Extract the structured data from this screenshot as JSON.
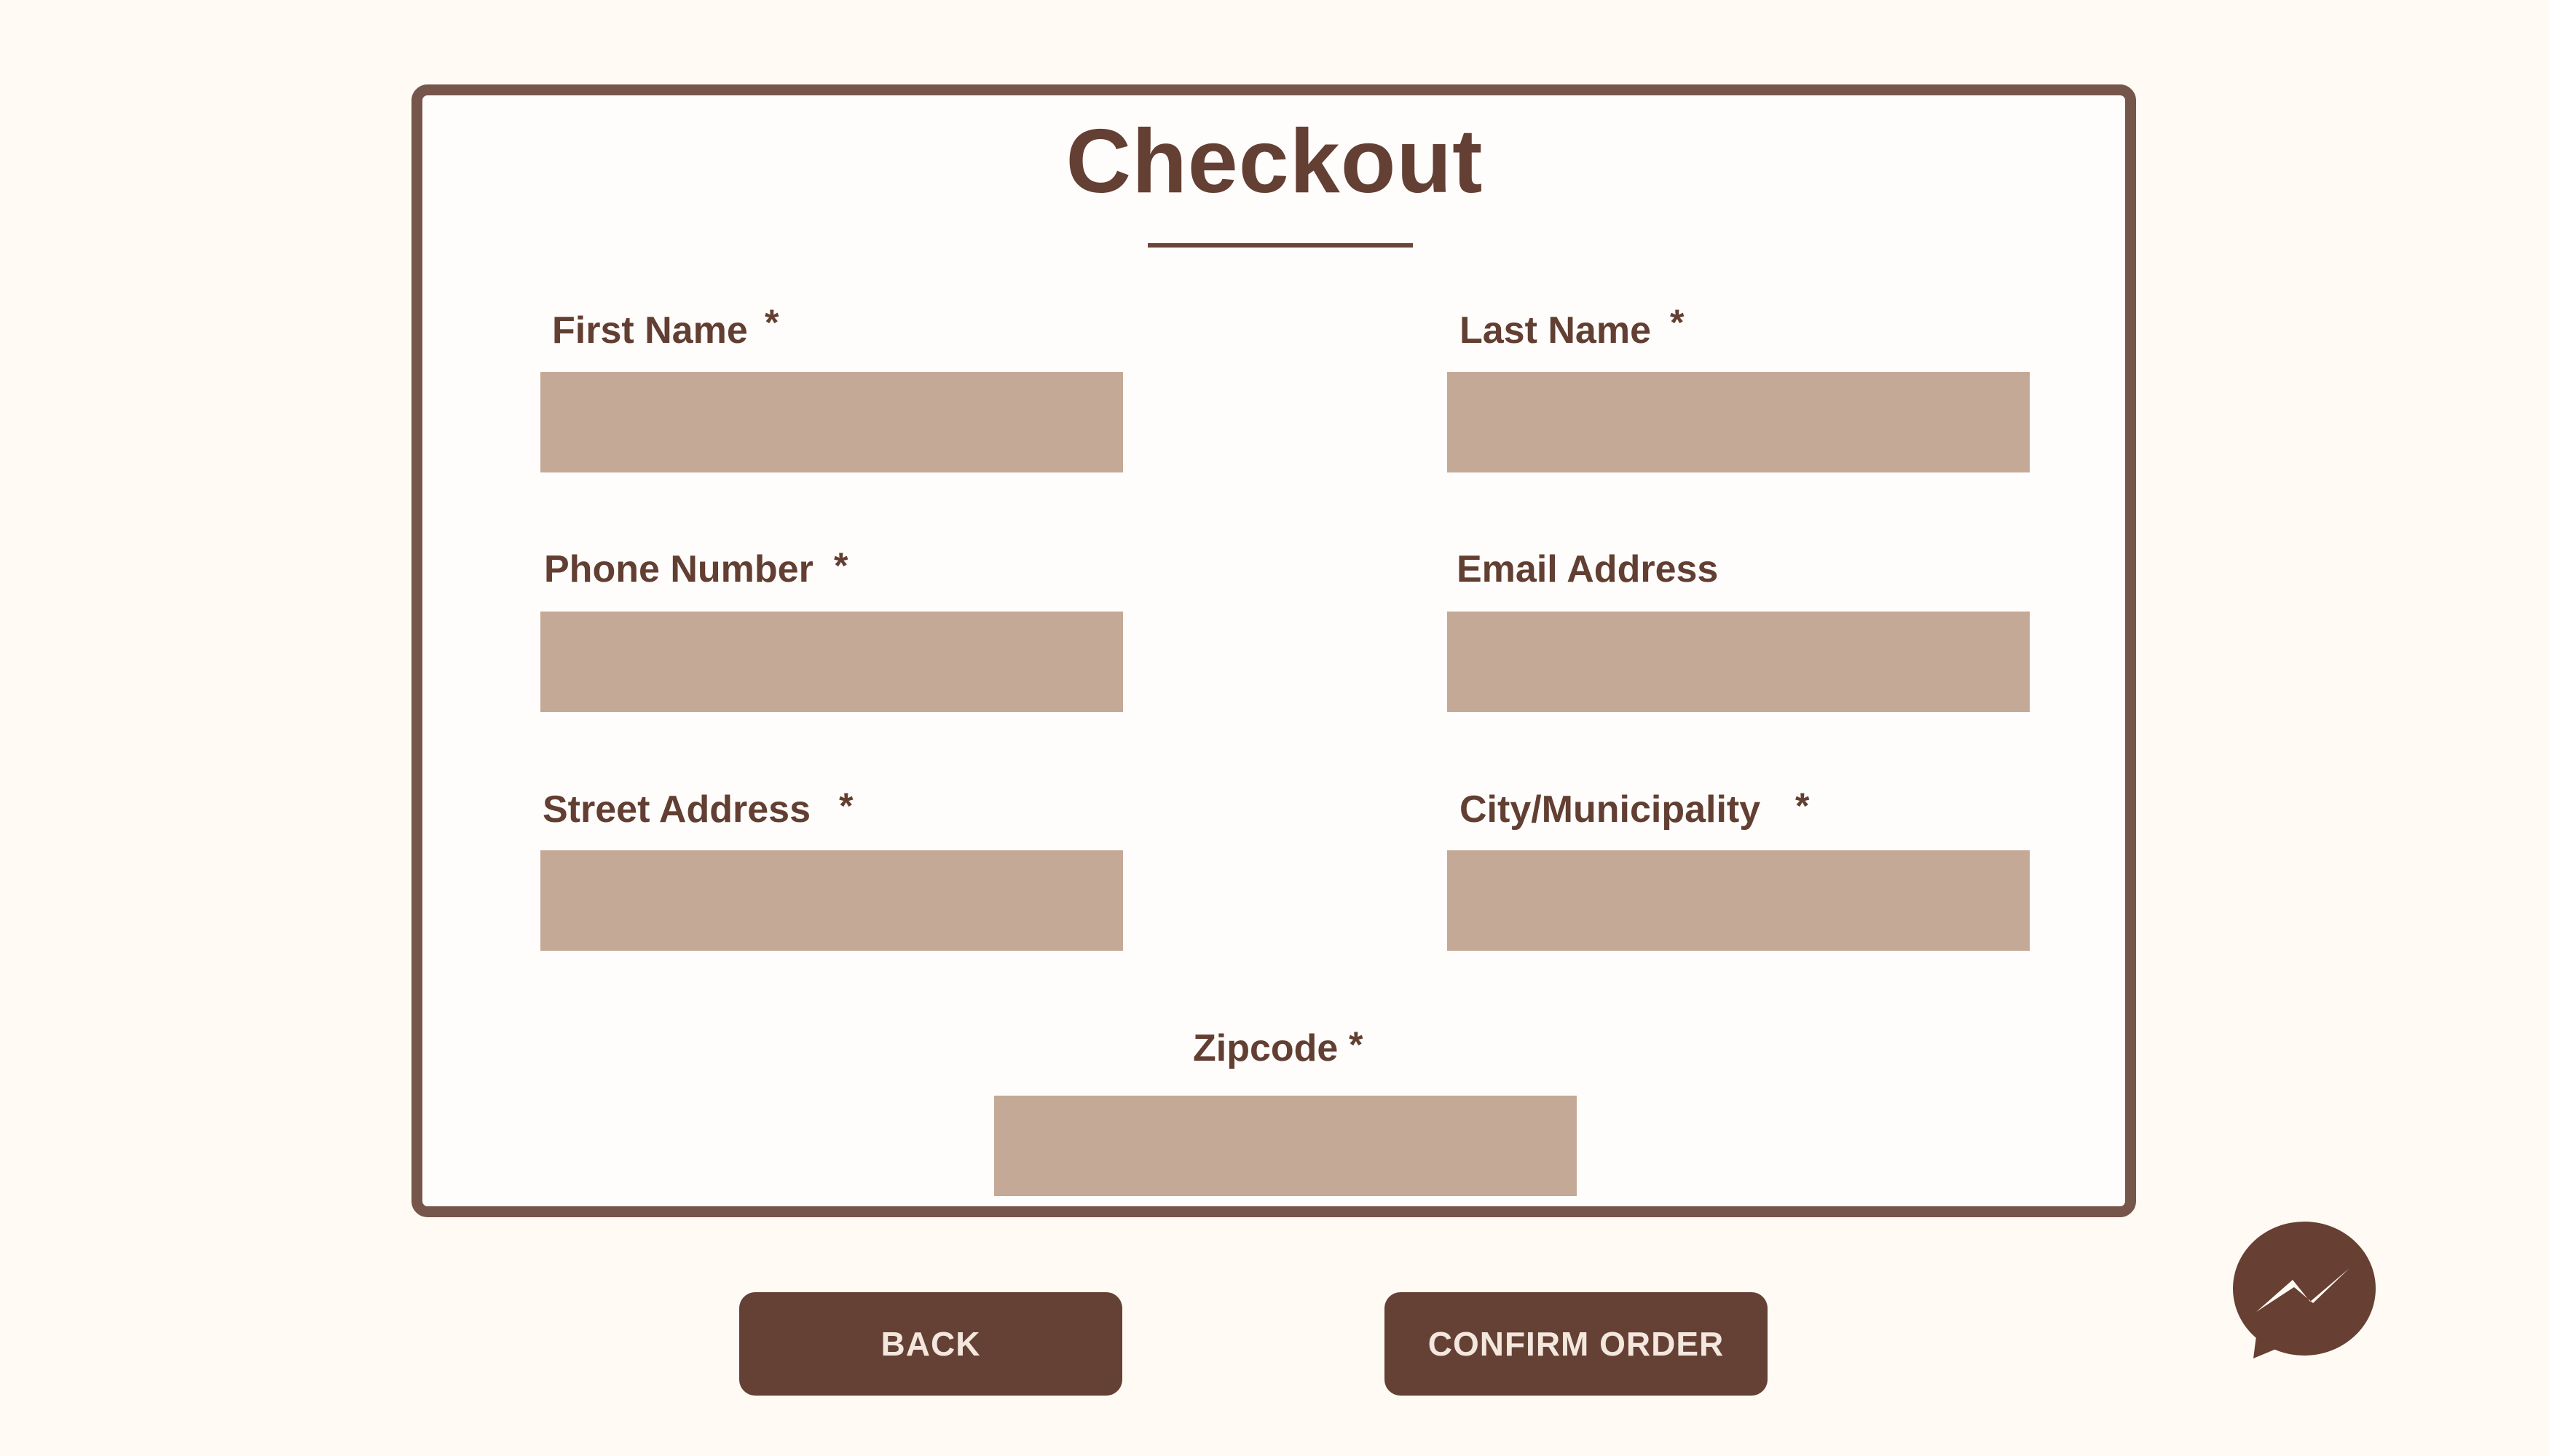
{
  "form": {
    "title": "Checkout",
    "required_mark": "*",
    "fields": [
      {
        "label": "First Name",
        "required": true,
        "value": "",
        "placeholder": ""
      },
      {
        "label": "Last Name",
        "required": true,
        "value": "",
        "placeholder": ""
      },
      {
        "label": "Phone Number",
        "required": true,
        "value": "",
        "placeholder": ""
      },
      {
        "label": "Email Address",
        "required": false,
        "value": "",
        "placeholder": ""
      },
      {
        "label": "Street Address",
        "required": true,
        "value": "",
        "placeholder": ""
      },
      {
        "label": "City/Municipality",
        "required": true,
        "value": "",
        "placeholder": ""
      },
      {
        "label": "Zipcode",
        "required": true,
        "value": "",
        "placeholder": ""
      }
    ]
  },
  "buttons": {
    "back_label": "BACK",
    "confirm_label": "CONFIRM ORDER"
  },
  "chat_widget": {
    "icon": "messenger-icon"
  },
  "colors": {
    "page_background": "#fffbf4",
    "card_border": "#76554a",
    "text": "#623f32",
    "input_fill": "#c4a996",
    "button_fill": "#654135",
    "button_text": "#f4e7de"
  }
}
